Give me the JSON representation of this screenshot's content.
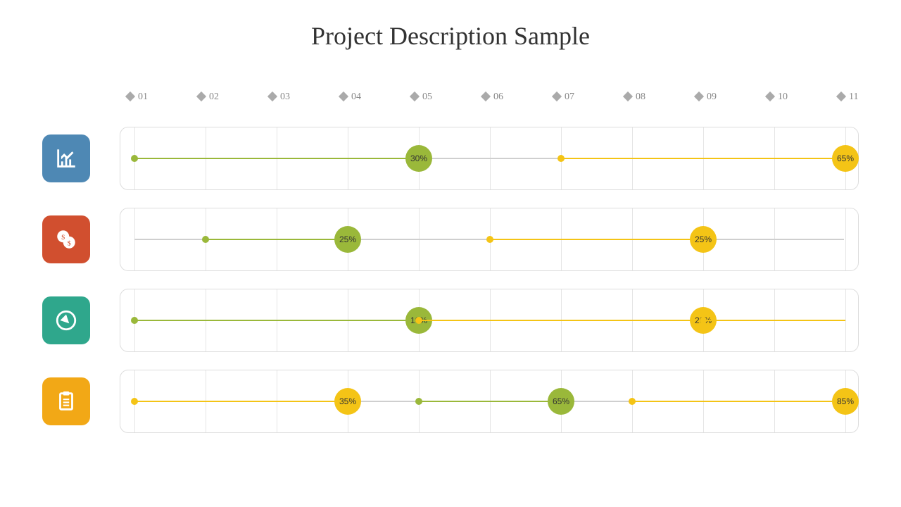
{
  "title": "Project Description Sample",
  "colors": {
    "green": "#9AB83A",
    "yellow": "#F4C416",
    "icon_blue": "#4E88B4",
    "icon_red": "#D14F2F",
    "icon_teal": "#2FA78C",
    "icon_orange": "#F2A816"
  },
  "chart_data": {
    "type": "gantt-range",
    "title": "Project Description Sample",
    "xlabel": "",
    "ylabel": "",
    "x_ticks": [
      "01",
      "02",
      "03",
      "04",
      "05",
      "06",
      "07",
      "08",
      "09",
      "10",
      "11"
    ],
    "x_range": [
      1,
      11
    ],
    "rows": [
      {
        "icon": "chart-growth",
        "icon_color": "#4E88B4",
        "segments": [
          {
            "start": 1,
            "end": 5,
            "color": "green",
            "label": "30%"
          },
          {
            "start": 7,
            "end": 11,
            "color": "yellow",
            "label": "65%"
          }
        ]
      },
      {
        "icon": "coins",
        "icon_color": "#D14F2F",
        "segments": [
          {
            "start": 2,
            "end": 4,
            "color": "green",
            "label": "25%"
          },
          {
            "start": 6,
            "end": 9,
            "color": "yellow",
            "label": "25%"
          }
        ]
      },
      {
        "icon": "compass",
        "icon_color": "#2FA78C",
        "segments": [
          {
            "start": 1,
            "end": 5,
            "color": "green",
            "label": "10%"
          },
          {
            "start": 5,
            "end": 9,
            "color": "yellow",
            "label": "20%"
          },
          {
            "start": 9,
            "end": 11,
            "color": "yellow",
            "label": null
          }
        ]
      },
      {
        "icon": "clipboard",
        "icon_color": "#F2A816",
        "segments": [
          {
            "start": 1,
            "end": 4,
            "color": "yellow",
            "label": "35%"
          },
          {
            "start": 5,
            "end": 7,
            "color": "green",
            "label": "65%"
          },
          {
            "start": 8,
            "end": 11,
            "color": "yellow",
            "label": "85%"
          }
        ]
      }
    ]
  }
}
